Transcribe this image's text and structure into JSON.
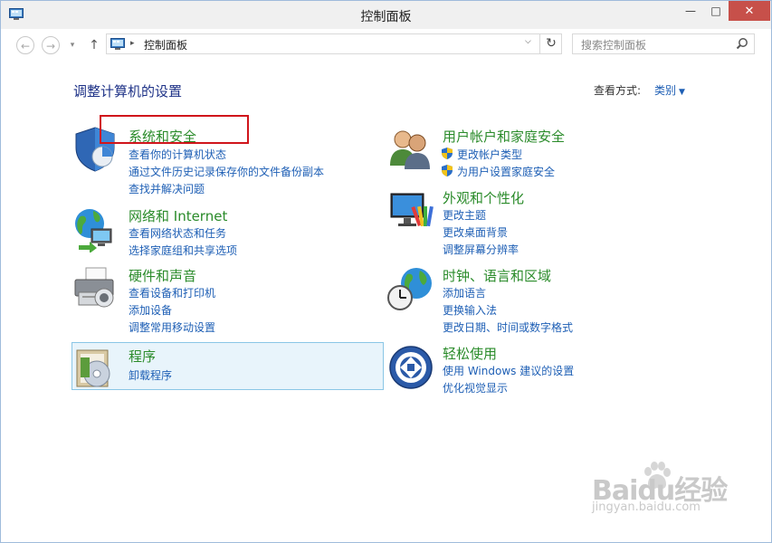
{
  "window": {
    "title": "控制面板"
  },
  "titlebar": {
    "minimize": "—",
    "maximize": "□",
    "close": "✕"
  },
  "nav": {
    "back": "←",
    "forward": "→",
    "recent": "▾",
    "up": "↑"
  },
  "address": {
    "separator": "▸",
    "crumb": "控制面板",
    "dropdown": "⌵",
    "refresh": "↻"
  },
  "search": {
    "placeholder": "搜索控制面板",
    "icon": "search-icon"
  },
  "main": {
    "heading": "调整计算机的设置",
    "view_by_label": "查看方式:",
    "view_by_value": "类别"
  },
  "categories": {
    "system": {
      "title": "系统和安全",
      "links": [
        "查看你的计算机状态",
        "通过文件历史记录保存你的文件备份副本",
        "查找并解决问题"
      ]
    },
    "network": {
      "title": "网络和 Internet",
      "links": [
        "查看网络状态和任务",
        "选择家庭组和共享选项"
      ]
    },
    "hardware": {
      "title": "硬件和声音",
      "links": [
        "查看设备和打印机",
        "添加设备",
        "调整常用移动设置"
      ]
    },
    "programs": {
      "title": "程序",
      "links": [
        "卸载程序"
      ]
    },
    "users": {
      "title": "用户帐户和家庭安全",
      "links": [
        "更改帐户类型",
        "为用户设置家庭安全"
      ]
    },
    "appearance": {
      "title": "外观和个性化",
      "links": [
        "更改主题",
        "更改桌面背景",
        "调整屏幕分辨率"
      ]
    },
    "clock": {
      "title": "时钟、语言和区域",
      "links": [
        "添加语言",
        "更换输入法",
        "更改日期、时间或数字格式"
      ]
    },
    "ease": {
      "title": "轻松使用",
      "links": [
        "使用 Windows 建议的设置",
        "优化视觉显示"
      ]
    }
  },
  "watermark": {
    "logo": "Baidu经验",
    "url": "jingyan.baidu.com"
  },
  "colors": {
    "category_title": "#2a8b2a",
    "link": "#1e5fb5",
    "heading": "#1e3287",
    "annotation": "#d0151b",
    "highlight": "#e8f4fb"
  }
}
